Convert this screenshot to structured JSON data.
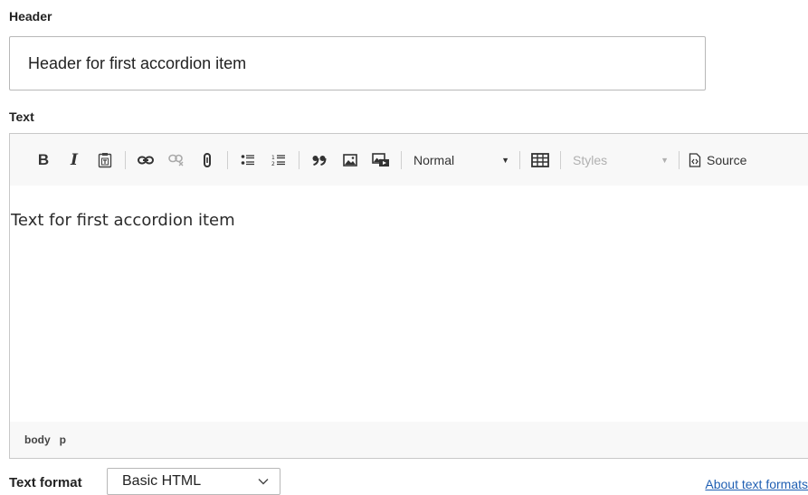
{
  "header_field": {
    "label": "Header",
    "value": "Header for first accordion item"
  },
  "text_field": {
    "label": "Text"
  },
  "toolbar": {
    "bold": "B",
    "italic": "I",
    "format_value": "Normal",
    "styles_placeholder": "Styles",
    "source_label": "Source",
    "icons": [
      "bold-icon",
      "italic-icon",
      "paste-text-icon",
      "link-icon",
      "unlink-icon",
      "anchor-icon",
      "bulleted-list-icon",
      "numbered-list-icon",
      "blockquote-icon",
      "image-icon",
      "media-icon",
      "table-icon",
      "source-icon"
    ]
  },
  "editor": {
    "content": "Text for first accordion item"
  },
  "path": [
    "body",
    "p"
  ],
  "text_format": {
    "label": "Text format",
    "value": "Basic HTML",
    "about_link": "About text formats"
  },
  "colors": {
    "link": "#1f5fb3",
    "toolbar_bg": "#f8f8f8",
    "border": "#b8b8b8"
  }
}
